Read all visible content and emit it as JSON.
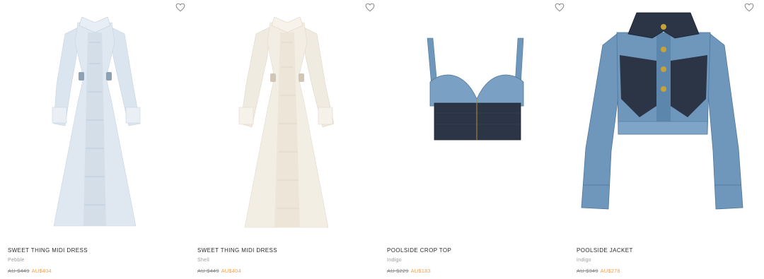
{
  "products": [
    {
      "name": "SWEET THING MIDI DRESS",
      "color": "Pebble",
      "was_price": "AU $449",
      "sale_price": "AU$404",
      "wishlist_icon": "heart-outline-icon"
    },
    {
      "name": "SWEET THING MIDI DRESS",
      "color": "Shell",
      "was_price": "AU $449",
      "sale_price": "AU$404",
      "wishlist_icon": "heart-outline-icon"
    },
    {
      "name": "POOLSIDE CROP TOP",
      "color": "Indigo",
      "was_price": "AU $229",
      "sale_price": "AU$183",
      "wishlist_icon": "heart-outline-icon"
    },
    {
      "name": "POOLSIDE JACKET",
      "color": "Indigo",
      "was_price": "AU $349",
      "sale_price": "AU$278",
      "wishlist_icon": "heart-outline-icon"
    }
  ],
  "colors": {
    "sale_price": "#f5a04a",
    "was_price": "#8a8a8a",
    "dress_pebble": "#dfe8f1",
    "dress_shell": "#f3eee4",
    "denim_light": "#6e97bb",
    "denim_dark": "#2b3546"
  }
}
